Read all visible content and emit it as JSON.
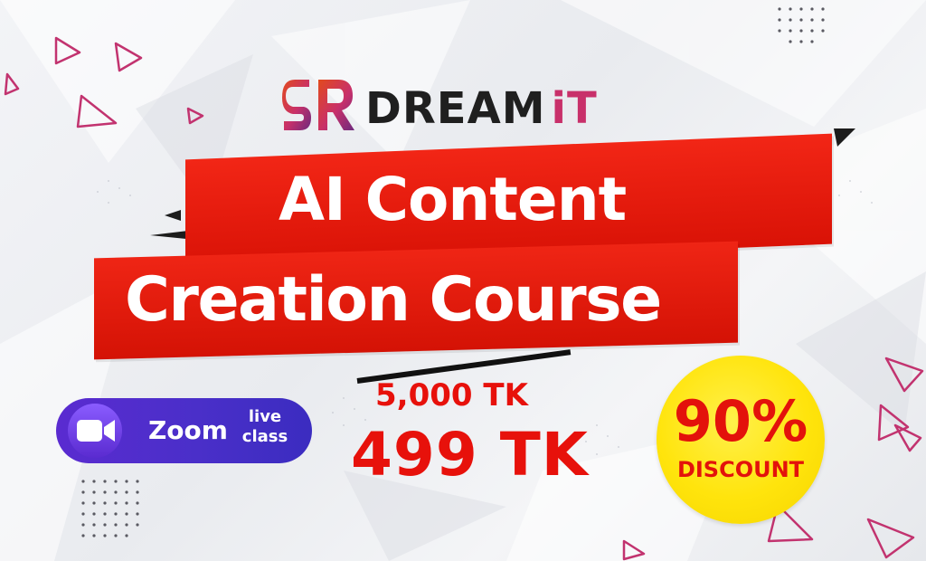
{
  "brand": {
    "logo_mark": "SR",
    "name_main": "DREAM",
    "name_accent": "iT",
    "colors": {
      "dark": "#1f1f1f",
      "accent": "#c8306a"
    }
  },
  "title": {
    "line1": "AI Content",
    "line2": "Creation Course",
    "ribbon_color": "#e8190f"
  },
  "zoom": {
    "label": "Zoom",
    "live_line1": "live",
    "live_line2": "class",
    "icon": "video-camera-icon",
    "color": "#4a2fc9"
  },
  "pricing": {
    "old_price": "5,000 TK",
    "new_price": "499 TK",
    "price_color": "#e7110b"
  },
  "discount": {
    "percent": "90%",
    "label": "DISCOUNT",
    "badge_color": "#ffe40c"
  }
}
